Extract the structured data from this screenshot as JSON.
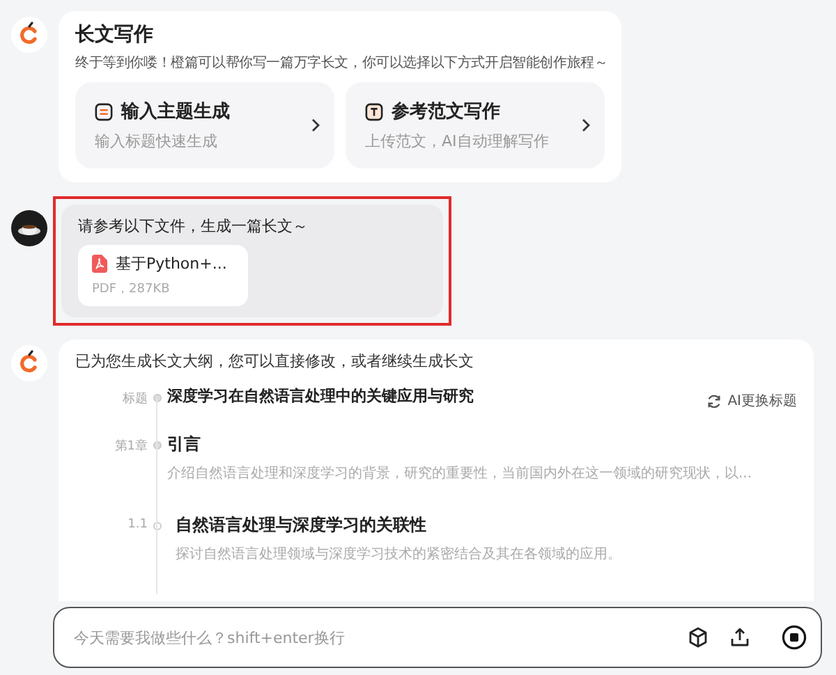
{
  "intro_card": {
    "title": "长文写作",
    "subtitle": "终于等到你喽！橙篇可以帮你写一篇万字长文，你可以选择以下方式开启智能创作旅程～",
    "options": [
      {
        "kind": "topic",
        "title": "输入主题生成",
        "description": "输入标题快速生成"
      },
      {
        "kind": "reference",
        "title": "参考范文写作",
        "description": "上传范文，AI自动理解写作"
      }
    ]
  },
  "user_message": {
    "text": "请参考以下文件，生成一篇长文～",
    "highlighted": true,
    "file": {
      "name": "基于Python+...",
      "meta": "PDF，287KB"
    }
  },
  "outline_card": {
    "intro": "已为您生成长文大纲，您可以直接修改，或者继续生成长文",
    "regenerate_button": "AI更换标题",
    "items": [
      {
        "kind": "title",
        "label": "标题",
        "title": "深度学习在自然语言处理中的关键应用与研究"
      },
      {
        "kind": "chapter",
        "label": "第1章",
        "title": "引言",
        "description": "介绍自然语言处理和深度学习的背景，研究的重要性，当前国内外在这一领域的研究现状，以..."
      },
      {
        "kind": "section",
        "label": "1.1",
        "title": "自然语言处理与深度学习的关联性",
        "description": "探讨自然语言处理领域与深度学习技术的紧密结合及其在各领域的应用。"
      }
    ]
  },
  "input": {
    "placeholder": "今天需要我做些什么？shift+enter换行"
  }
}
